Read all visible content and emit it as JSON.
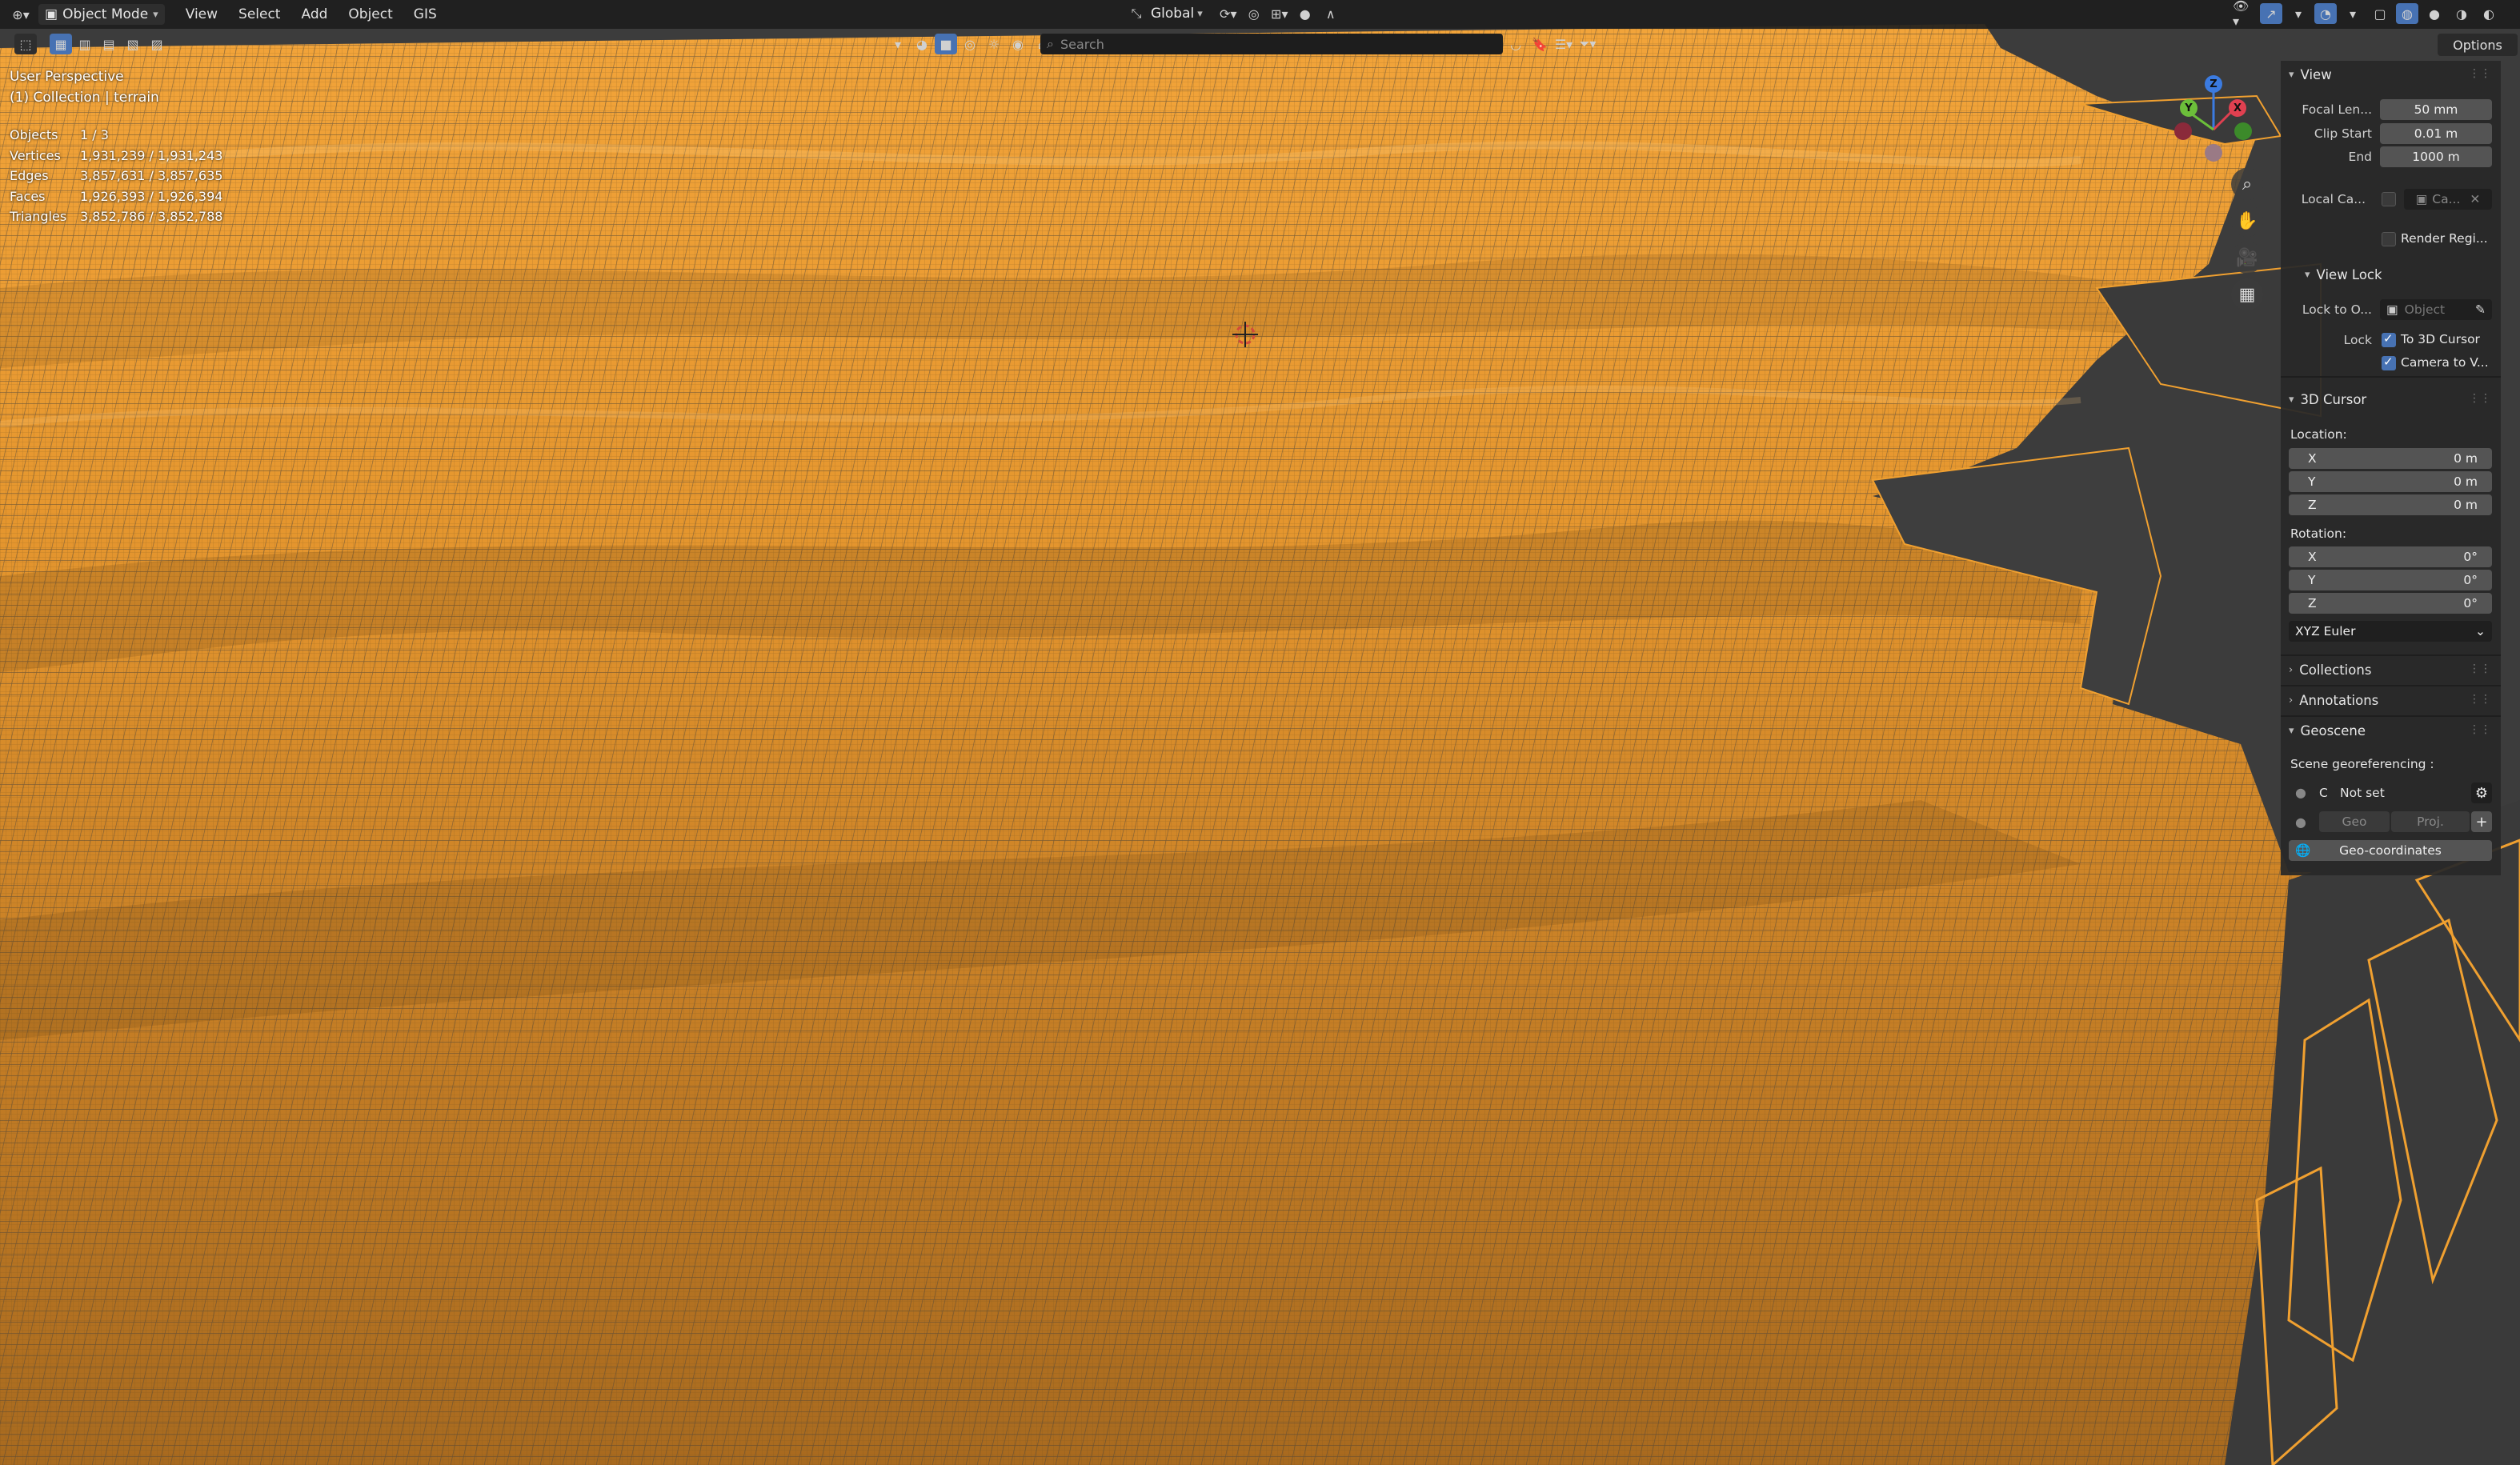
{
  "header": {
    "mode": "Object Mode",
    "menus": [
      "View",
      "Select",
      "Add",
      "Object",
      "GIS"
    ],
    "transform_orientation": "Global",
    "options_label": "Options"
  },
  "toolbar": {
    "search_placeholder": "Search"
  },
  "overlay": {
    "perspective": "User Perspective",
    "collection": "(1) Collection | terrain"
  },
  "stats": [
    {
      "label": "Objects",
      "value": "1 / 3"
    },
    {
      "label": "Vertices",
      "value": "1,931,239 / 1,931,243"
    },
    {
      "label": "Edges",
      "value": "3,857,631 / 3,857,635"
    },
    {
      "label": "Faces",
      "value": "1,926,393 / 1,926,394"
    },
    {
      "label": "Triangles",
      "value": "3,852,786 / 3,852,788"
    }
  ],
  "gizmo": {
    "x": "X",
    "y": "Y",
    "z": "Z"
  },
  "sidebar": {
    "view": {
      "title": "View",
      "focal_label": "Focal Len...",
      "focal_value": "50 mm",
      "clip_start_label": "Clip Start",
      "clip_start_value": "0.01 m",
      "end_label": "End",
      "end_value": "1000 m",
      "local_camera_label": "Local Ca...",
      "local_camera_value": "Ca...",
      "render_region_label": "Render Regi..."
    },
    "view_lock": {
      "title": "View Lock",
      "lock_to_label": "Lock to O...",
      "lock_to_placeholder": "Object",
      "lock_label": "Lock",
      "to_cursor": "To 3D Cursor",
      "camera_to_view": "Camera to V..."
    },
    "cursor": {
      "title": "3D Cursor",
      "location_label": "Location:",
      "loc": [
        {
          "axis": "X",
          "value": "0 m"
        },
        {
          "axis": "Y",
          "value": "0 m"
        },
        {
          "axis": "Z",
          "value": "0 m"
        }
      ],
      "rotation_label": "Rotation:",
      "rot": [
        {
          "axis": "X",
          "value": "0°"
        },
        {
          "axis": "Y",
          "value": "0°"
        },
        {
          "axis": "Z",
          "value": "0°"
        }
      ],
      "rotation_mode": "XYZ Euler"
    },
    "collections_title": "Collections",
    "annotations_title": "Annotations",
    "geoscene": {
      "title": "Geoscene",
      "scene_label": "Scene georeferencing :",
      "crs_letter": "C",
      "crs_value": "Not set",
      "geo_btn": "Geo",
      "proj_btn": "Proj.",
      "geocoords_btn": "Geo-coordinates"
    }
  },
  "colors": {
    "wire_orange": "#f0a030",
    "background": "#3c3c3c",
    "panel": "#282828",
    "accent_blue": "#4772b3"
  }
}
